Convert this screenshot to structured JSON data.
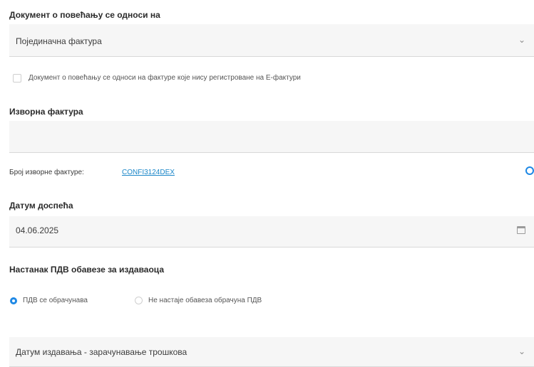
{
  "document_related": {
    "label": "Документ о повећању се односи на",
    "value": "Појединачна фактура",
    "unregistered_checkbox_label": "Документ о повећању се односи на фактуре које нису регистроване на Е-фактури"
  },
  "source_invoice": {
    "label": "Изворна фактура",
    "value": "",
    "number_label": "Број изворне фактуре:",
    "number_value": "CONFI3124DEX"
  },
  "due_date": {
    "label": "Датум доспећа",
    "value": "04.06.2025"
  },
  "vat_obligation": {
    "label": "Настанак ПДВ обавезе за издаваоца",
    "options": [
      {
        "label": "ПДВ се обрачунава",
        "selected": true
      },
      {
        "label": "Не настаје обавеза обрачуна ПДВ",
        "selected": false
      }
    ],
    "date_basis_value": "Датум издавања - зарачунавање трошкова"
  },
  "icons": {
    "chevron": "chevron-down-icon",
    "calendar": "calendar-icon",
    "clear": "clear-icon"
  },
  "colors": {
    "accent": "#1e88e5",
    "link": "#1a86c8"
  }
}
